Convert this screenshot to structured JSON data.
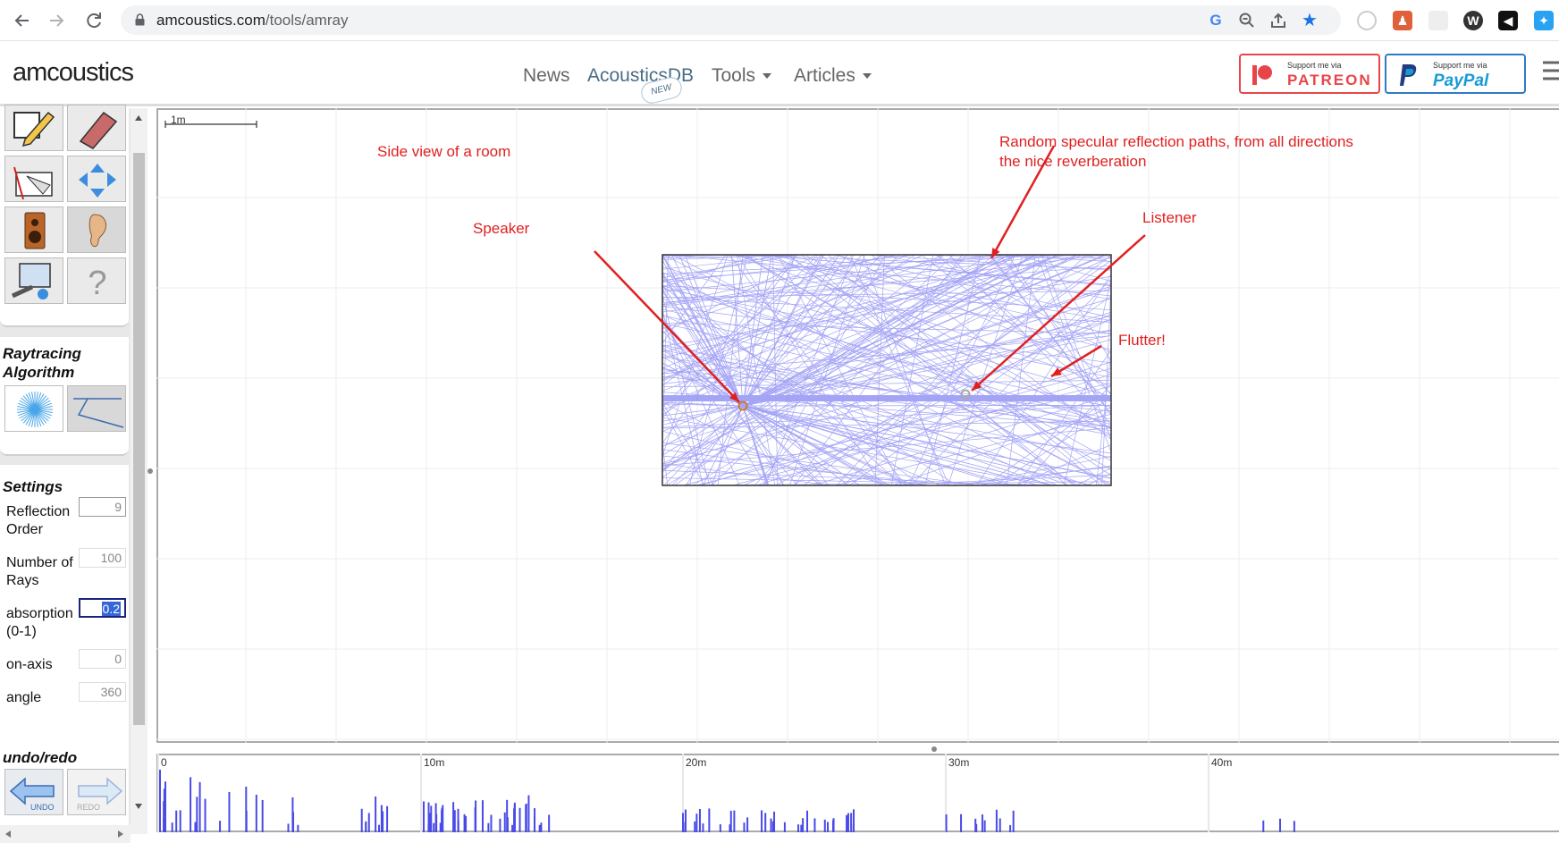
{
  "browser": {
    "url_host": "amcoustics.com",
    "url_path": "/tools/amray"
  },
  "site": {
    "logo": "amcoustics",
    "nav": [
      {
        "label": "News"
      },
      {
        "label": "AcousticsDB"
      },
      {
        "label": "Tools"
      },
      {
        "label": "Articles"
      }
    ],
    "new_badge": "NEW",
    "patreon": {
      "small": "Support me via",
      "big": "PATREON"
    },
    "paypal": {
      "small": "Support me via",
      "big": "PayPal"
    }
  },
  "panel": {
    "raytracing_title": "Raytracing Algorithm",
    "settings_title": "Settings",
    "settings": [
      {
        "label": "Reflection Order",
        "value": "9"
      },
      {
        "label": "Number of Rays",
        "value": "100"
      },
      {
        "label": "absorption (0-1)",
        "value": "0.2"
      },
      {
        "label": "on-axis",
        "value": "0"
      },
      {
        "label": "angle",
        "value": "360"
      }
    ],
    "undo_title": "undo/redo",
    "undo_label": "UNDO",
    "redo_label": "REDO"
  },
  "canvas": {
    "scale_label": "1m",
    "annotations": {
      "side_view": "Side view of a room",
      "random": "Random specular reflection paths,  from all directions",
      "nice": "the nice reverberation",
      "speaker": "Speaker",
      "listener": "Listener",
      "flutter": "Flutter!"
    },
    "ray_color": "#5a5af0",
    "arrow_color": "#e02020"
  },
  "timeline": {
    "ticks": [
      "0",
      "10m",
      "20m",
      "30m",
      "40m"
    ],
    "bar_color": "#4a4ae8"
  }
}
